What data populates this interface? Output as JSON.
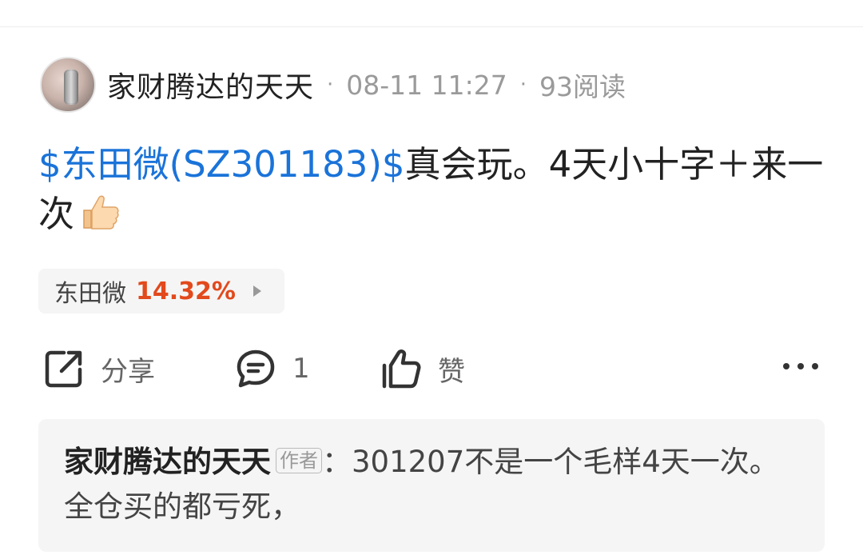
{
  "post": {
    "author": "家财腾达的天天",
    "timestamp": "08-11 11:27",
    "reads": "93阅读",
    "stock_tag": "$东田微(SZ301183)$",
    "text": "真会玩。4天小十字＋来一次",
    "emoji": "thumbs-up-icon"
  },
  "stock_chip": {
    "name": "东田微",
    "change": "14.32%",
    "change_color": "#e2491c"
  },
  "actions": {
    "share_label": "分享",
    "comment_count": "1",
    "like_label": "赞"
  },
  "comment": {
    "author": "家财腾达的天天",
    "badge": "作者",
    "separator": "：",
    "text": "301207不是一个毛样4天一次。全仓买的都亏死，"
  },
  "colors": {
    "link": "#1a73d9",
    "meta": "#9a9a9a",
    "box_bg": "#f5f5f5"
  }
}
